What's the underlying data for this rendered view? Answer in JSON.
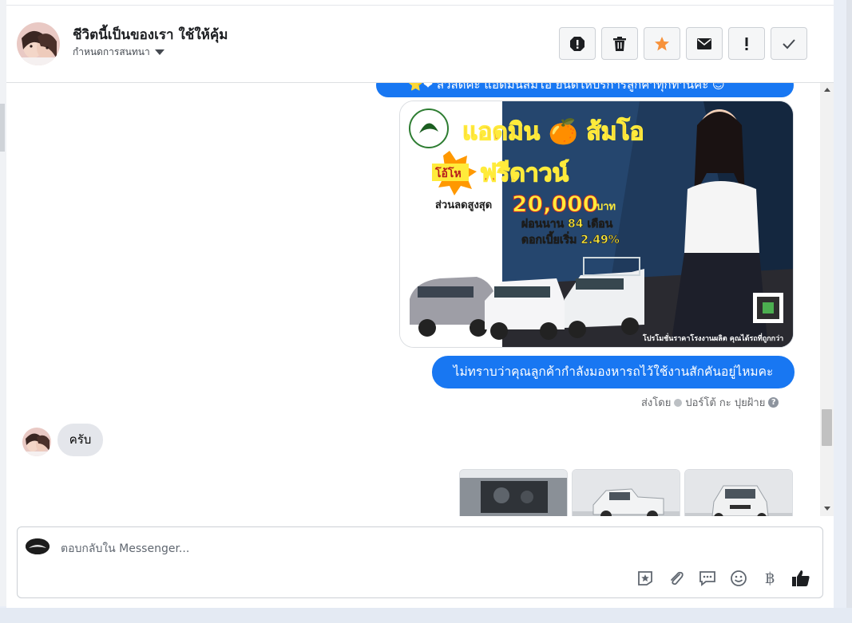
{
  "header": {
    "title": "ชีวิตนี้เป็นของเรา ใช้ให้คุ้ม",
    "subtitle": "กำหนดการสนทนา",
    "actions": [
      "spam-icon",
      "trash-icon",
      "star-icon",
      "envelope-icon",
      "important-icon",
      "check-icon"
    ],
    "star_color": "#f7923b"
  },
  "messages": {
    "outgoing_top_partial": "⭐❤ สวัสดีค่ะ แอดมินส้มโอ ยินดีให้บริการลูกค้าทุกท่านค่ะ 😊",
    "promo": {
      "headline": "แอดมิน 🍊 ส้มโอ",
      "badge": "โอ้โห",
      "free": "ฟรีดาวน์",
      "discount_label": "ส่วนลดสูงสุด",
      "discount_value": "20,000",
      "discount_unit": "บาท",
      "installment": "ผ่อนนาน 84 เดือน",
      "interest": "ดอกเบี้ยเริ่ม 2.49%",
      "footer": "โปรโมชั่นราคาโรงงานผลิต คุณได้รถที่ถูกกว่า"
    },
    "outgoing_question": "ไม่ทราบว่าคุณลูกค้ากำลังมองหารถไว้ใช้งานสักคันอยู่ไหมคะ",
    "sent_by_prefix": "ส่งโดย",
    "sent_by_name": "ปอร์โต้ กะ ปุยฝ้าย",
    "incoming_reply": "ครับ"
  },
  "composer": {
    "placeholder": "ตอบกลับใน Messenger...",
    "tools": [
      "sticker-icon",
      "attachment-icon",
      "saved-reply-icon",
      "emoji-icon",
      "baht-icon",
      "like-icon"
    ],
    "baht_symbol": "฿"
  }
}
